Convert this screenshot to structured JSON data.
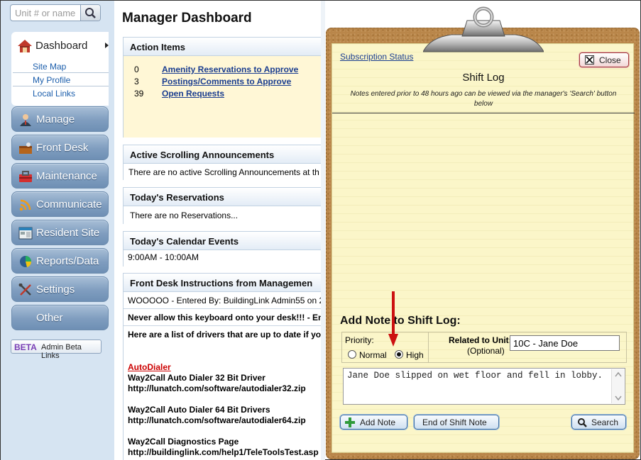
{
  "sidebar": {
    "search_placeholder": "Unit # or name",
    "dashboard_label": "Dashboard",
    "sublinks": [
      "Site Map",
      "My Profile",
      "Local Links"
    ],
    "nav": [
      "Manage",
      "Front Desk",
      "Maintenance",
      "Communicate",
      "Resident Site",
      "Reports/Data",
      "Settings",
      "Other"
    ],
    "beta_badge": "BETA",
    "beta_label": "Admin Beta Links"
  },
  "main": {
    "title": "Manager Dashboard",
    "action_items": {
      "header": "Action Items",
      "rows": [
        {
          "count": "0",
          "label": "Amenity Reservations to Approve"
        },
        {
          "count": "3",
          "label": "Postings/Comments to Approve"
        },
        {
          "count": "39",
          "label": "Open Requests"
        }
      ]
    },
    "announcements": {
      "header": "Active Scrolling Announcements",
      "text": "There are no active Scrolling Announcements at th"
    },
    "reservations": {
      "header": "Today's Reservations",
      "text": "There are no Reservations..."
    },
    "calendar": {
      "header": "Today's Calendar Events",
      "text": "9:00AM - 10:00AM"
    },
    "front_desk": {
      "header": "Front Desk Instructions from Managemen",
      "line1": "WOOOOO - Entered By: BuildingLink Admin55 on 2",
      "line2": "Never allow this keyboard onto your desk!!! - Ente",
      "line3": "Here are a list of drivers that are up to date if you",
      "autodialer": "AutoDialer",
      "d1_title": "Way2Call Auto Dialer 32 Bit Driver",
      "d1_url": "http://lunatch.com/software/autodialer32.zip",
      "d2_title": "Way2Call Auto Dialer 64 Bit Drivers",
      "d2_url": "http://lunatch.com/software/autodialer64.zip",
      "d3_title": "Way2Call Diagnostics Page",
      "d3_url": "http://buildinglink.com/help1/TeleToolsTest.asp"
    }
  },
  "shift_log": {
    "subscription_status": "Subscription Status",
    "close_label": "Close",
    "title": "Shift Log",
    "note": "Notes entered prior to 48 hours ago can be viewed via the manager's 'Search' button below",
    "add_title": "Add Note to Shift Log:",
    "priority_label": "Priority:",
    "priority_options": [
      "Normal",
      "High"
    ],
    "priority_selected": "High",
    "related_label": "Related to Unit:",
    "optional_label": "(Optional)",
    "unit_value": "10C - Jane Doe",
    "note_text": "Jane Doe slipped on wet floor and fell in lobby.",
    "add_note_label": "Add Note",
    "end_shift_label": "End of Shift Note",
    "search_label": "Search"
  },
  "colors": {
    "link": "#1a3d8f",
    "nav_blue": "#7f9dbf",
    "arrow_red": "#cc1111",
    "clipboard": "#b9864a",
    "autodialer_red": "#cc0000"
  },
  "icons": [
    "search-icon",
    "home-icon",
    "manager-icon",
    "front-desk-icon",
    "toolbox-icon",
    "wifi-icon",
    "resident-site-icon",
    "pie-chart-icon",
    "tools-icon",
    "close-icon",
    "plus-icon",
    "magnifier-icon"
  ]
}
